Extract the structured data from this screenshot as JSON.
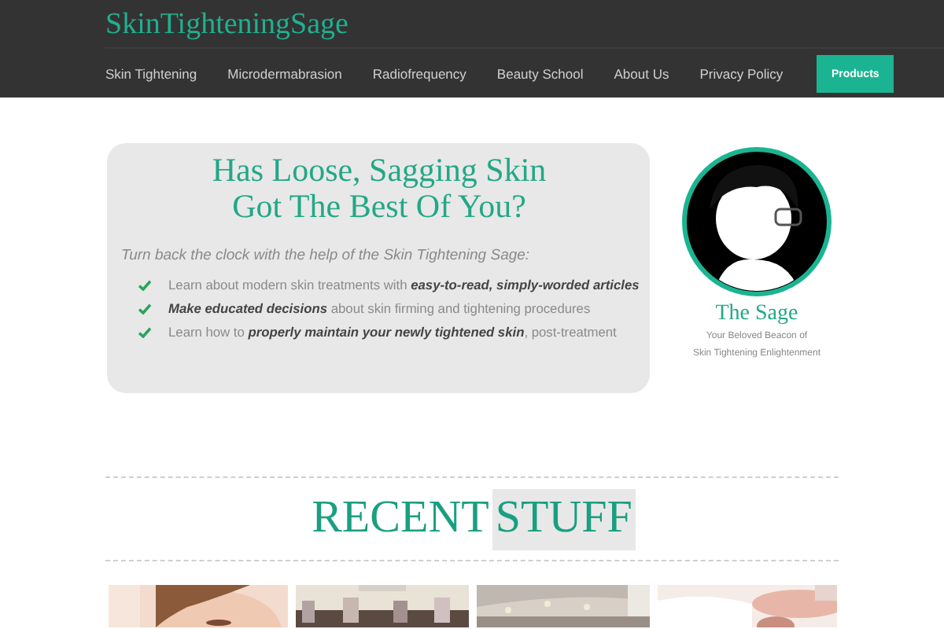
{
  "header": {
    "logo": "SkinTighteningSage",
    "nav": [
      {
        "label": "Skin Tightening"
      },
      {
        "label": "Microdermabrasion"
      },
      {
        "label": "Radiofrequency"
      },
      {
        "label": "Beauty School"
      },
      {
        "label": "About Us"
      },
      {
        "label": "Privacy Policy"
      }
    ],
    "cta_button": "Products"
  },
  "hero": {
    "title_lines": [
      "Has Loose, Sagging Skin",
      "Got The Best Of You?"
    ],
    "intro": "Turn back the clock with the help of the Skin Tightening Sage:",
    "bullets": [
      "Learn about modern skin treatments with **easy-to-read, simply-worded articles**",
      "**Make educated decisions** about skin firming and tightening procedures",
      "Learn how to **properly maintain your newly tightened skin**, post-treatment"
    ]
  },
  "sage": {
    "avatar": {
      "kind": "picture"
    },
    "name": "The Sage",
    "tagline_lines": [
      "Your Beloved Beacon of",
      "Skin Tightening Enlightenment"
    ]
  },
  "recent": {
    "heading": [
      {
        "text": "RECENT",
        "highlighted": false
      },
      {
        "text": "STUFF",
        "highlighted": true
      }
    ],
    "posts": [
      {
        "kind": "picture"
      },
      {
        "kind": "picture"
      },
      {
        "kind": "picture"
      },
      {
        "kind": "picture"
      }
    ]
  }
}
